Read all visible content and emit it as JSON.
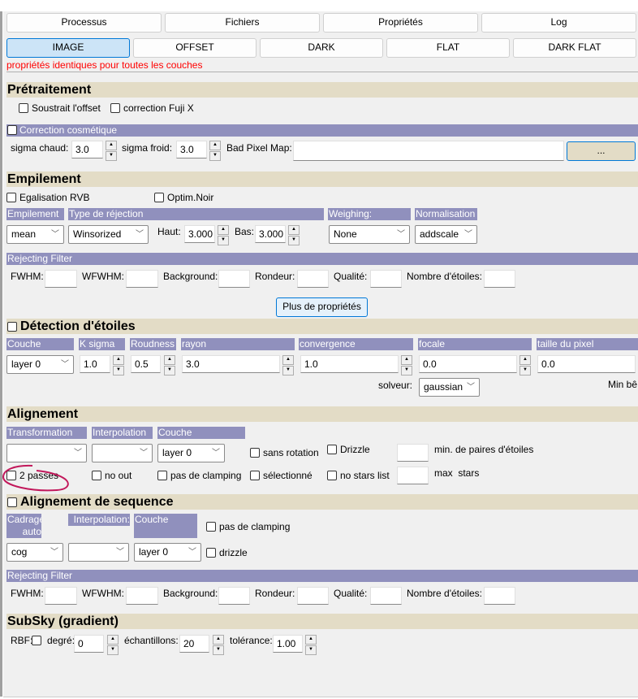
{
  "top_tabs": [
    "Processus",
    "Fichiers",
    "Propriétés",
    "Log"
  ],
  "layer_tabs": [
    "IMAGE",
    "OFFSET",
    "DARK",
    "FLAT",
    "DARK FLAT"
  ],
  "notice": "propriétés identiques pour toutes les couches",
  "pre": {
    "title": "Prétraitement",
    "offset": "Soustrait l'offset",
    "fuji": "correction Fuji X",
    "cosm": "Correction cosmétique",
    "sigma_hot": "sigma chaud:",
    "sigma_hot_val": "3.0",
    "sigma_cold": "sigma froid:",
    "sigma_cold_val": "3.0",
    "bpm": "Bad Pixel Map:",
    "browse": "..."
  },
  "stack": {
    "title": "Empilement",
    "rvb": "Egalisation RVB",
    "noir": "Optim.Noir",
    "l_stack": "Empilement",
    "l_rej": "Type de réjection",
    "l_weigh": "Weighing:",
    "l_norm": "Normalisation",
    "stack_val": "mean",
    "rej_val": "Winsorized",
    "haut": "Haut:",
    "haut_val": "3.000",
    "bas": "Bas:",
    "bas_val": "3.000",
    "weigh_val": "None",
    "norm_val": "addscale"
  },
  "filter": {
    "title": "Rejecting Filter",
    "fwhm": "FWHM:",
    "wfwhm": "WFWHM:",
    "bg": "Background:",
    "round": "Rondeur:",
    "qual": "Qualité:",
    "nstars": "Nombre d'étoiles:"
  },
  "more": "Plus de propriétés",
  "detect": {
    "title": "Détection d'étoiles",
    "labels": [
      "Couche",
      "K sigma",
      "Roudness",
      "rayon",
      "convergence",
      "focale",
      "taille du pixel"
    ],
    "layer": "layer 0",
    "ksigma": "1.0",
    "roundness": "0.5",
    "radius": "3.0",
    "conv": "1.0",
    "focal": "0.0",
    "pixel": "0.0",
    "solver": "solveur:",
    "solver_val": "gaussian",
    "minbeta": "Min bê"
  },
  "align": {
    "title": "Alignement",
    "l_trans": "Transformation",
    "l_interp": "Interpolation",
    "l_layer": "Couche",
    "layer": "layer 0",
    "norot": "sans rotation",
    "drizzle": "Drizzle",
    "minpairs": "min. de paires d'étoiles",
    "passes": "2 passes",
    "noout": "no out",
    "noclamp": "pas de clamping",
    "selected": "sélectionné",
    "nostars": "no stars list",
    "maxstars": "max  stars"
  },
  "seq": {
    "title": "Alignement de sequence",
    "l_crop": "Cadrage auto",
    "l_interp": "Interpolation:",
    "l_layer": "Couche",
    "noclamp": "pas de clamping",
    "crop_val": "cog",
    "layer": "layer 0",
    "drizzle": "drizzle"
  },
  "subsky": {
    "title": "SubSky (gradient)",
    "rbf": "RBF:",
    "degree": "degré:",
    "degree_val": "0",
    "samples": "échantillons:",
    "samples_val": "20",
    "tol": "tolérance:",
    "tol_val": "1.00"
  },
  "colors": {
    "header": "#e3dcc6",
    "label": "#9090bd",
    "notice": "#ff0000",
    "annotation": "#c2185b"
  }
}
